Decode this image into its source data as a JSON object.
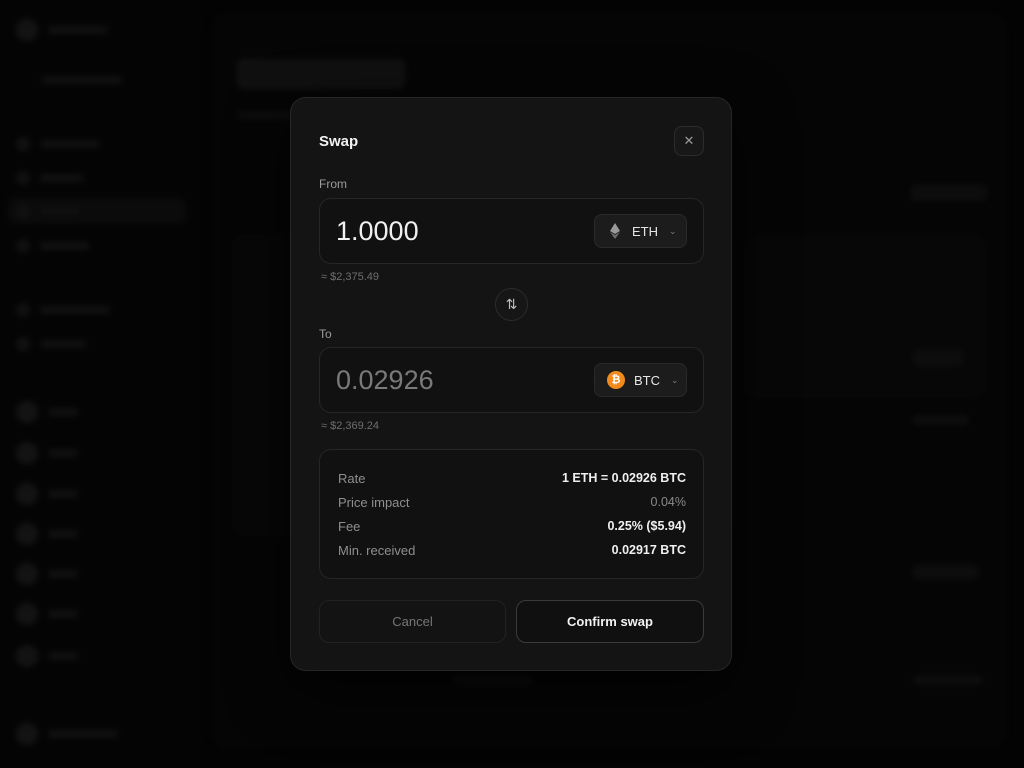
{
  "modal": {
    "title": "Swap",
    "close_glyph": "✕",
    "from": {
      "label": "From",
      "amount": "1.0000",
      "token": "ETH",
      "usd_value": "≈ $2,375.49"
    },
    "to": {
      "label": "To",
      "amount": "0.02926",
      "token": "BTC",
      "token_glyph": "₿",
      "usd_value": "≈ $2,369.24"
    },
    "flip_glyph": "⇅",
    "details": {
      "rate_label": "Rate",
      "rate_value": "1 ETH = 0.02926 BTC",
      "impact_label": "Price impact",
      "impact_value": "0.04%",
      "fee_label": "Fee",
      "fee_value": "0.25% ($5.94)",
      "min_label": "Min. received",
      "min_value": "0.02917 BTC"
    },
    "cancel_label": "Cancel",
    "confirm_label": "Confirm swap"
  },
  "icons": {
    "from_token_icon": "ethereum-icon",
    "to_token_icon": "bitcoin-icon",
    "flip_icon": "swap-vertical-icon",
    "close_icon": "close-icon"
  },
  "colors": {
    "btc_orange": "#f28b1c",
    "modal_bg": "#141414",
    "page_bg": "#050505"
  }
}
